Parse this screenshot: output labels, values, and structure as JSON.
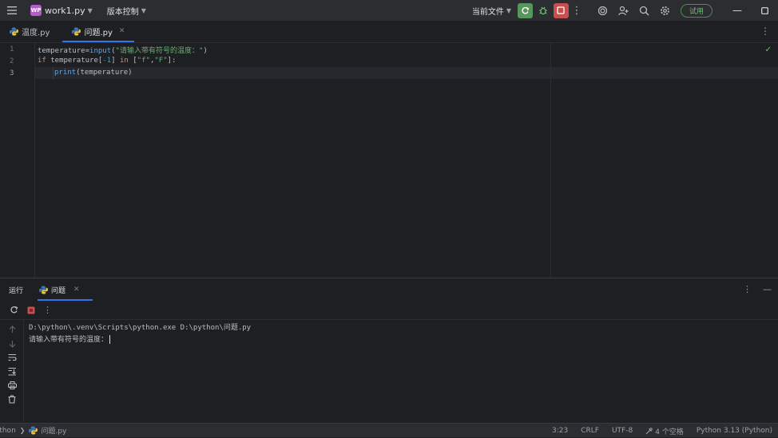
{
  "titlebar": {
    "project_badge": "WP",
    "project_name": "work1.py",
    "vcs_label": "版本控制",
    "current_file_label": "当前文件",
    "trial_label": "试用"
  },
  "tabs": [
    {
      "label": "温度.py"
    },
    {
      "label": "问题.py"
    }
  ],
  "editor": {
    "line_numbers": [
      "1",
      "2",
      "3"
    ],
    "line1": {
      "a": "temperature=",
      "b": "input",
      "c": "(",
      "d": "\"请输入带有符号的温度：\"",
      "e": ")"
    },
    "line2": {
      "a": "if",
      "b": " temperature[",
      "c": "-1",
      "d": "] ",
      "e": "in",
      "f": " [",
      "g": "\"f\"",
      "h": ",",
      "i": "\"F\"",
      "j": "]:"
    },
    "line3": {
      "a": "print",
      "b": "(temperature)"
    }
  },
  "run_panel": {
    "title": "运行",
    "tab_label": "问题",
    "output_line1": "D:\\python\\.venv\\Scripts\\python.exe D:\\python\\问题.py",
    "output_line2": "请输入带有符号的温度："
  },
  "statusbar": {
    "breadcrumb_root": "ython",
    "breadcrumb_file": "问题.py",
    "position": "3:23",
    "line_ending": "CRLF",
    "encoding": "UTF-8",
    "indent": "4 个空格",
    "interpreter": "Python 3.13 (Python)"
  },
  "colors": {
    "accent": "#3574f0",
    "run_green": "#57965c",
    "stop_red": "#c94f4f"
  }
}
